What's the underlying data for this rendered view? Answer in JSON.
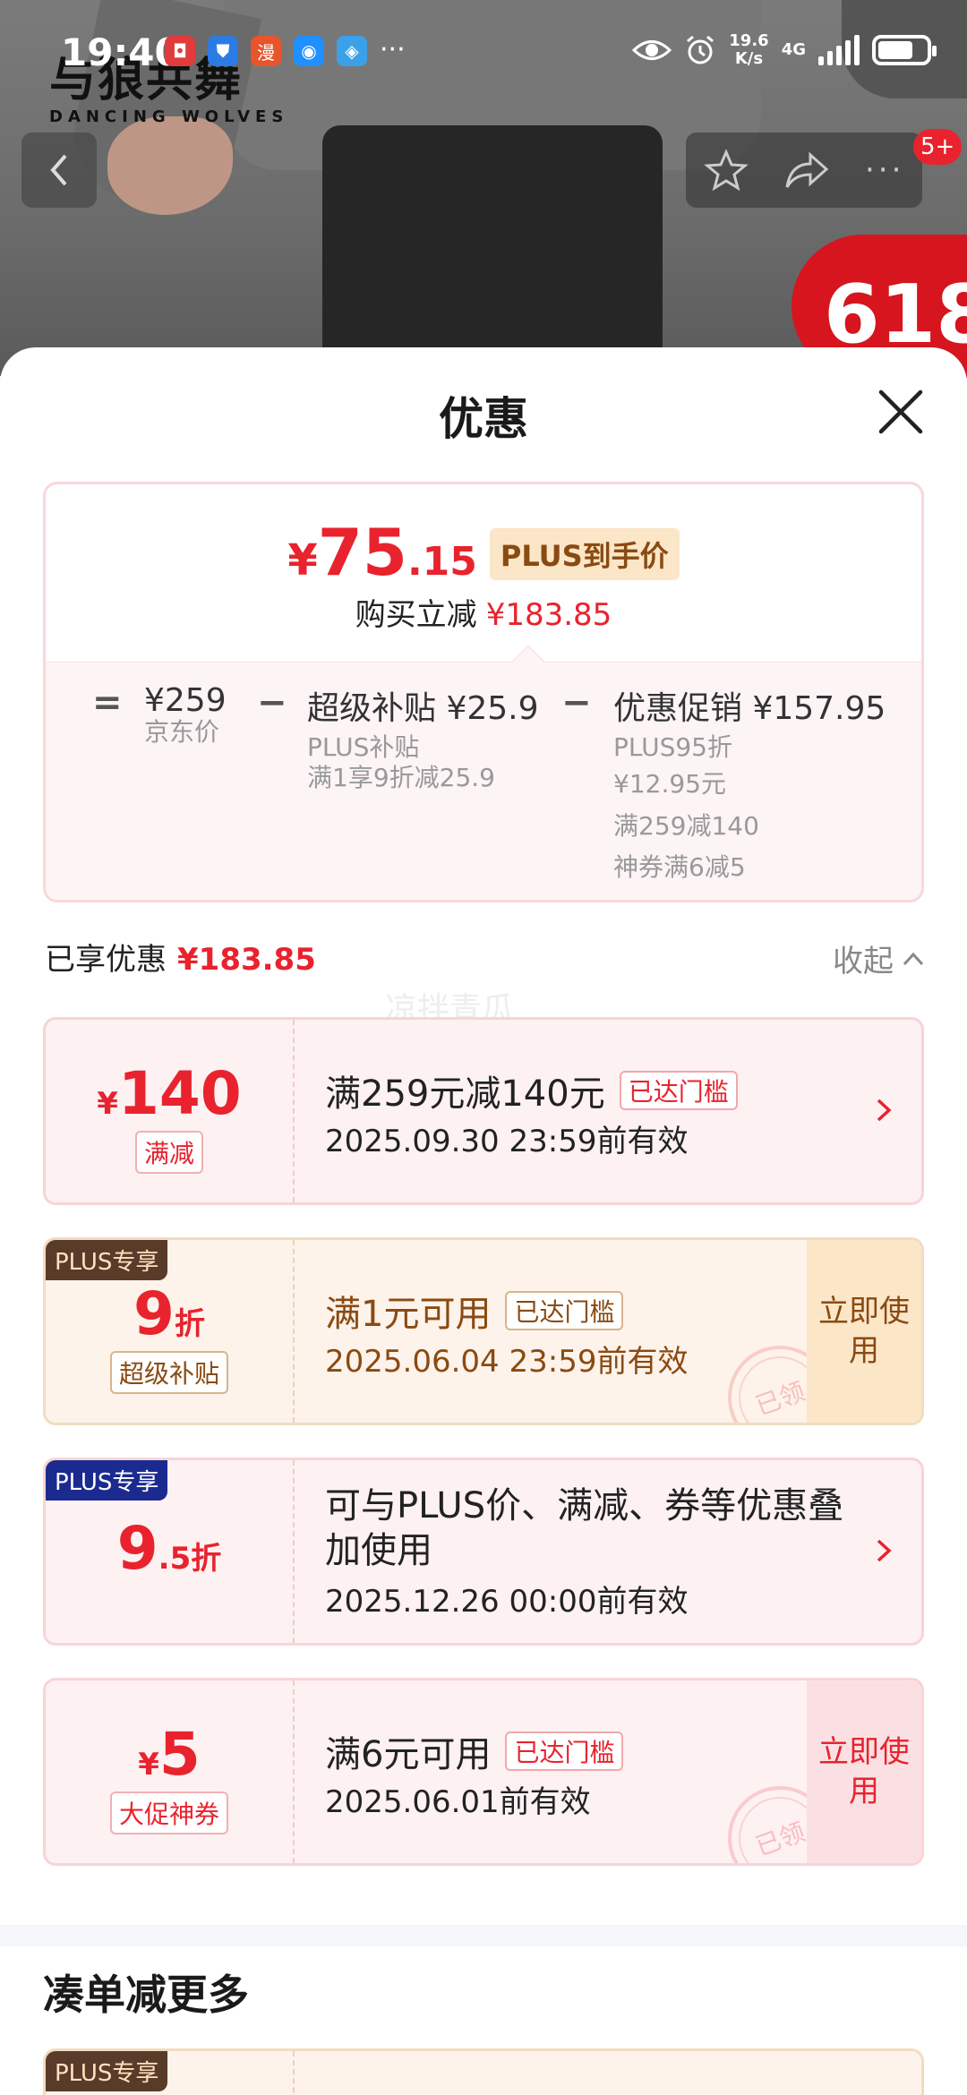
{
  "status_bar": {
    "time": "19:40",
    "net_speed": "19.6",
    "net_unit": "K/s",
    "network": "4G"
  },
  "brand": {
    "cn": "与狼共舞",
    "en": "DANCING WOLVES"
  },
  "header": {
    "message_badge": "5+",
    "promo": "618"
  },
  "sheet": {
    "title": "优惠",
    "price": {
      "currency": "¥",
      "integer": "75",
      "decimal": ".15",
      "plus_tag": "PLUS到手价",
      "reduce_label": "购买立减",
      "reduce_amount": "¥183.85"
    },
    "breakdown": {
      "eq": "=",
      "jd_price": "¥259",
      "jd_label": "京东价",
      "minus": "−",
      "subsidy": "超级补贴 ¥25.9",
      "subsidy_lines": [
        "PLUS补贴",
        "满1享9折减25.9"
      ],
      "promo": "优惠促销 ¥157.95",
      "promo_lines": [
        "PLUS95折",
        "¥12.95元",
        "满259减140",
        "神券满6减5"
      ]
    },
    "enjoyed": {
      "label": "已享优惠",
      "amount": "¥183.85",
      "collapse": "收起"
    },
    "watermark": "凉拌青瓜",
    "coupons": [
      {
        "value_prefix": "¥",
        "value": "140",
        "type": "满减",
        "title": "满259元减140元",
        "tag": "已达门槛",
        "date": "2025.09.30 23:59前有效"
      },
      {
        "badge": "PLUS专享",
        "value": "9",
        "value_suffix": "折",
        "type": "超级补贴",
        "title": "满1元可用",
        "tag": "已达门槛",
        "date": "2025.06.04 23:59前有效",
        "button": "立即使用",
        "stamp": "已领"
      },
      {
        "badge": "PLUS专享",
        "value": "9",
        "value_suffix": ".5折",
        "title": "可与PLUS价、满减、券等优惠叠加使用",
        "date": "2025.12.26 00:00前有效"
      },
      {
        "value_prefix": "¥",
        "value": "5",
        "type": "大促神券",
        "title": "满6元可用",
        "tag": "已达门槛",
        "date": "2025.06.01前有效",
        "button": "立即使用",
        "stamp": "已领"
      }
    ],
    "more_title": "凑单减更多",
    "peek_badge": "PLUS专享"
  },
  "colors": {
    "accent": "#e8232e",
    "gold": "#8a4a12",
    "plus_blue": "#1b2a8f"
  }
}
